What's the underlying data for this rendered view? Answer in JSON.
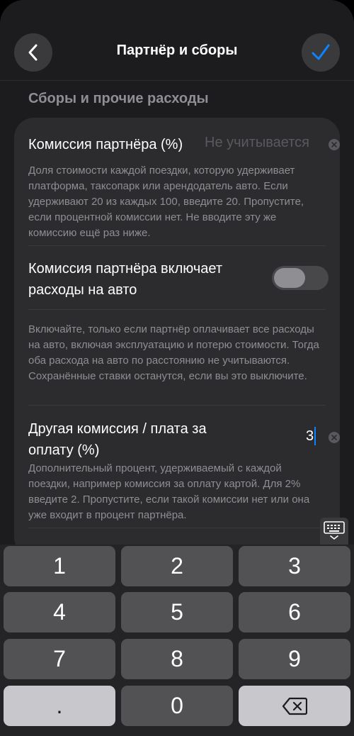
{
  "header": {
    "title": "Партнёр и сборы",
    "back_icon": "chevron-left-icon",
    "done_icon": "checkmark-icon",
    "accent_color": "#0a84ff"
  },
  "section": {
    "title": "Сборы и прочие расходы"
  },
  "fields": {
    "partner_commission": {
      "label": "Комиссия партнёра (%)",
      "placeholder": "Не учитывается",
      "help": "Доля стоимости каждой поездки, которую удерживает платформа, таксопарк или арендодатель авто. Если удерживают 20 из каждых 100, введите 20. Пропустите, если процентной комиссии нет. Не вводите эту же комиссию ещё раз ниже."
    },
    "includes_car_costs": {
      "label": "Комиссия партнёра включает расходы на авто",
      "enabled": false,
      "help": "Включайте, только если партнёр оплачивает все расходы на авто, включая эксплуатацию и потерю стоимости. Тогда оба расхода на авто по расстоянию не учитываются. Сохранённые ставки останутся, если вы это выключите."
    },
    "other_fee": {
      "label": "Другая комиссия / плата за оплату (%)",
      "value": "3",
      "help": "Дополнительный процент, удерживаемый с каждой поездки, например комиссия за оплату картой. Для 2% введите 2. Пропустите, если такой комиссии нет или она уже входит в процент партнёра."
    }
  },
  "keyboard": {
    "dismiss_icon": "keyboard-dismiss-icon",
    "keys": [
      "1",
      "2",
      "3",
      "4",
      "5",
      "6",
      "7",
      "8",
      "9",
      ".",
      "0"
    ],
    "backspace_icon": "backspace-icon"
  }
}
